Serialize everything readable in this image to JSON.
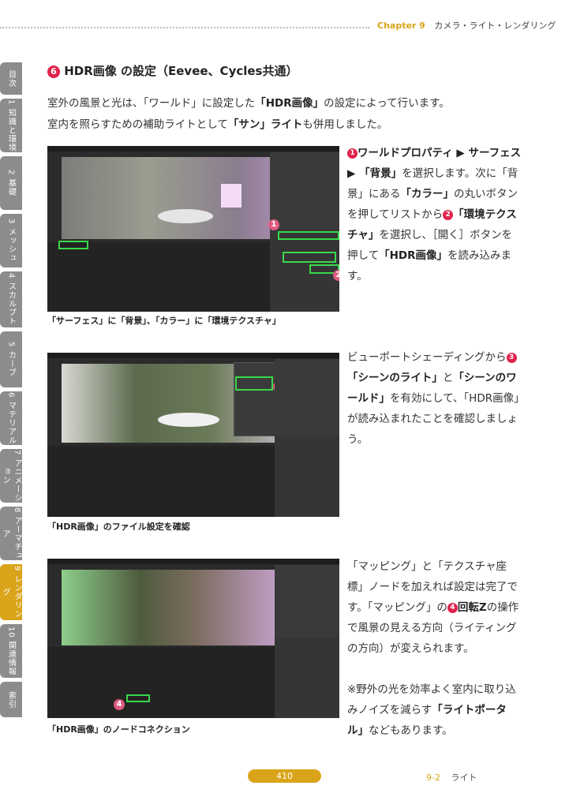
{
  "header": {
    "chapter_num": "Chapter 9",
    "chapter_title": "カメラ・ライト・レンダリング"
  },
  "section": {
    "num": "6",
    "title": "HDR画像 の設定（Eevee、Cycles共通）"
  },
  "intro": {
    "l1a": "室外の風景と光は、「ワールド」に設定した",
    "l1b": "「HDR画像」",
    "l1c": "の設定によって行います。",
    "l2a": "室内を照らすための補助ライトとして",
    "l2b": "「サン」ライト",
    "l2c": "も併用しました。"
  },
  "step1": {
    "m1": "1",
    "a": "ワールドプロパティ ▶ サーフェス ▶ 「背景」",
    "b": "を選択します。次に「背景」にある",
    "c": "「カラー」",
    "d": "の丸いボタンを押してリストから",
    "m2": "2",
    "e": "「環境テクスチャ」",
    "f": "を選択し、［開く］ボタンを押して",
    "g": "「HDR画像」",
    "h": "を読み込みます。"
  },
  "step2": {
    "a": "ビューポートシェーディングから",
    "m": "3",
    "b": "「シーンのライト」",
    "c": "と",
    "d": "「シーンのワールド」",
    "e": "を有効にして、「HDR画像」が読み込まれたことを確認しましょう。"
  },
  "step3": {
    "a": "「マッピング」と「テクスチャ座標」ノードを加えれば設定は完了です。「マッピング」の",
    "m": "4",
    "b": "回転Z",
    "c": "の操作で風景の見える方向（ライティングの方向）が変えられます。",
    "d": "※野外の光を効率よく室内に取り込みノイズを減らす",
    "e": "「ライトポータル」",
    "f": "などもあります。"
  },
  "captions": {
    "c1": "「サーフェス」に「背景」、「カラー」に「環境テクスチャ」",
    "c2": "「HDR画像」のファイル設定を確認",
    "c3": "「HDR画像」のノードコネクション"
  },
  "screenshots": {
    "m1": "1",
    "m2": "2",
    "m3": "3",
    "m4": "4"
  },
  "tabs": [
    {
      "label": "目次"
    },
    {
      "label": "1 知識と環境"
    },
    {
      "label": "2 基礎"
    },
    {
      "label": "3 メッシュ"
    },
    {
      "label": "4 スカルプト"
    },
    {
      "label": "5 カーブ"
    },
    {
      "label": "6 マテリアル"
    },
    {
      "label": "7 アニメーション"
    },
    {
      "label": "8 アーマチュア"
    },
    {
      "label": "9 レンダリング"
    },
    {
      "label": "10 関連情報"
    },
    {
      "label": "索引"
    }
  ],
  "footer": {
    "page": "410",
    "sec_num": "9-2",
    "sec_title": "ライト"
  },
  "colors": {
    "accent": "#d9a419",
    "marker": "#e0234b",
    "tab": "#8c8c8c"
  }
}
